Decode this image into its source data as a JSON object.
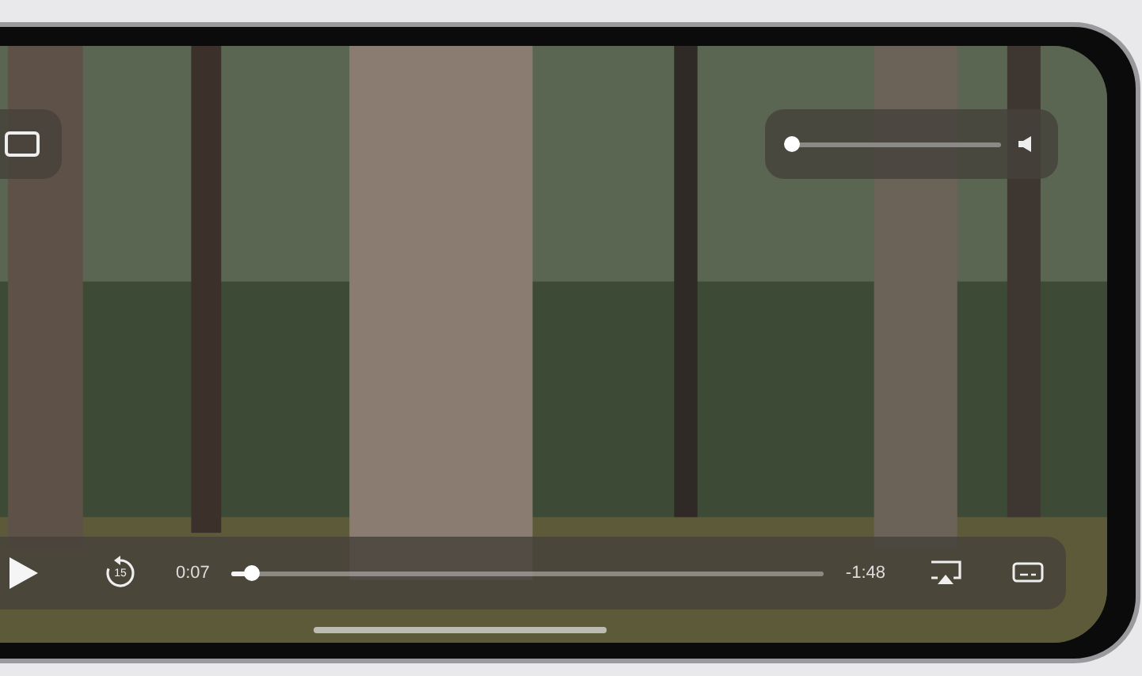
{
  "player": {
    "elapsed": "0:07",
    "remaining": "-1:48",
    "skip_label": "15",
    "progress": {
      "level": 0.035
    },
    "volume": {
      "level": 0.02
    }
  }
}
